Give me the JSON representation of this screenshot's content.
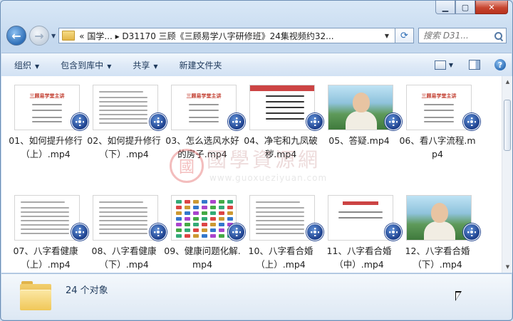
{
  "window": {
    "caption_buttons": {
      "minimize": "▁",
      "maximize": "▢",
      "close": "✕"
    }
  },
  "nav": {
    "address_path": "«  国学...  ▸  D31170 三顾《三顾易学八字研修班》24集视频约32...",
    "search_placeholder": "搜索 D31...",
    "icons": [
      "back-arrow-icon",
      "forward-arrow-icon",
      "folder-icon",
      "refresh-icon",
      "search-icon"
    ]
  },
  "toolbar": {
    "organize": "组织",
    "include_in_library": "包含到库中",
    "share": "共享",
    "new_folder": "新建文件夹",
    "help": "?"
  },
  "files": [
    {
      "name": "01、如何提升修行（上）.mp4",
      "thumb": "slide",
      "slide_title": "三顾易学堂主讲"
    },
    {
      "name": "02、如何提升修行（下）.mp4",
      "thumb": "doc"
    },
    {
      "name": "03、怎么选风水好的房子.mp4",
      "thumb": "slide",
      "slide_title": "三顾易学堂主讲"
    },
    {
      "name": "04、净宅和九凤破秽.mp4",
      "thumb": "redslide"
    },
    {
      "name": "05、答疑.mp4",
      "thumb": "video"
    },
    {
      "name": "06、看八字流程.mp4",
      "thumb": "slide",
      "slide_title": "三顾易学堂主讲"
    },
    {
      "name": "07、八字看健康（上）.mp4",
      "thumb": "doc"
    },
    {
      "name": "08、八字看健康（下）.mp4",
      "thumb": "doc"
    },
    {
      "name": "09、健康问题化解.mp4",
      "thumb": "colorgrid"
    },
    {
      "name": "10、八字看合婚（上）.mp4",
      "thumb": "doc"
    },
    {
      "name": "11、八字看合婚（中）.mp4",
      "thumb": "redtitle"
    },
    {
      "name": "12、八字看合婚（下）.mp4",
      "thumb": "video"
    }
  ],
  "watermark": {
    "seal": "國",
    "text": "國學資源網",
    "url": "www.guoxueziyuan.com"
  },
  "details": {
    "count": "24 个对象"
  }
}
